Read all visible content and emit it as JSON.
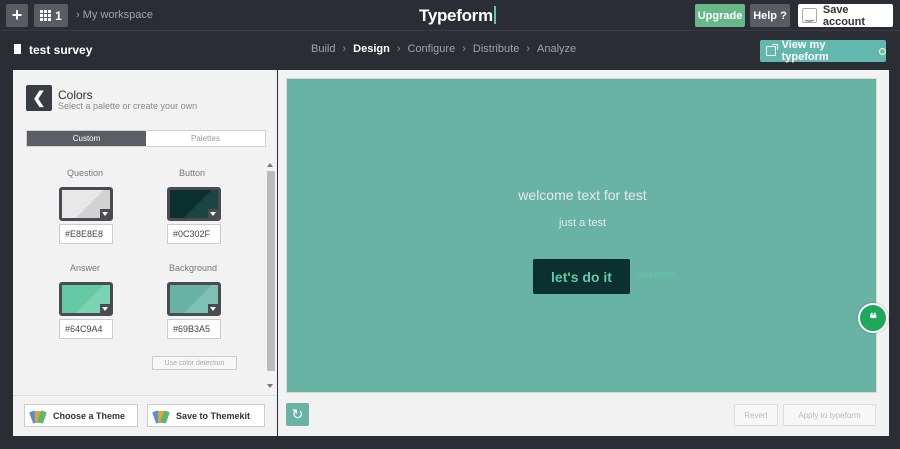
{
  "topbar": {
    "workspace_count": "1",
    "breadcrumb": "My workspace",
    "logo": "Typeform",
    "upgrade_label": "Upgrade",
    "help_label": "Help ?",
    "save_account_label": "Save account"
  },
  "subbar": {
    "survey_title": "test survey",
    "steps": [
      "Build",
      "Design",
      "Configure",
      "Distribute",
      "Analyze"
    ],
    "active_step": "Design",
    "view_button": "View my typeform"
  },
  "panel": {
    "title": "Colors",
    "subtitle": "Select a palette or create your own",
    "tabs": [
      "Custom",
      "Palettes"
    ],
    "active_tab": "Custom",
    "colors": [
      {
        "label": "Question",
        "hex": "#E8E8E8"
      },
      {
        "label": "Button",
        "hex": "#0C302F"
      },
      {
        "label": "Answer",
        "hex": "#64C9A4"
      },
      {
        "label": "Background",
        "hex": "#69B3A5"
      }
    ],
    "detect_label": "Use color detection",
    "choose_theme_label": "Choose a Theme",
    "save_themekit_label": "Save to Themekit"
  },
  "preview": {
    "welcome_text": "welcome text for test",
    "sub_text": "just a test",
    "cta_label": "let's do it",
    "press_hint": "press ENTER",
    "revert_label": "Revert",
    "apply_label": "Apply to typeform"
  },
  "colors": {
    "background": "#69b3a5",
    "question": "#e8e8e8",
    "button": "#0c302f",
    "answer": "#64c9a4",
    "accent_green": "#67b889",
    "chrome": "#2b2d34"
  },
  "icons": [
    "plus-icon",
    "grid-icon",
    "smiley-icon",
    "document-icon",
    "external-link-icon",
    "back-arrow-icon",
    "refresh-icon",
    "quote-icon",
    "palette-icon"
  ]
}
